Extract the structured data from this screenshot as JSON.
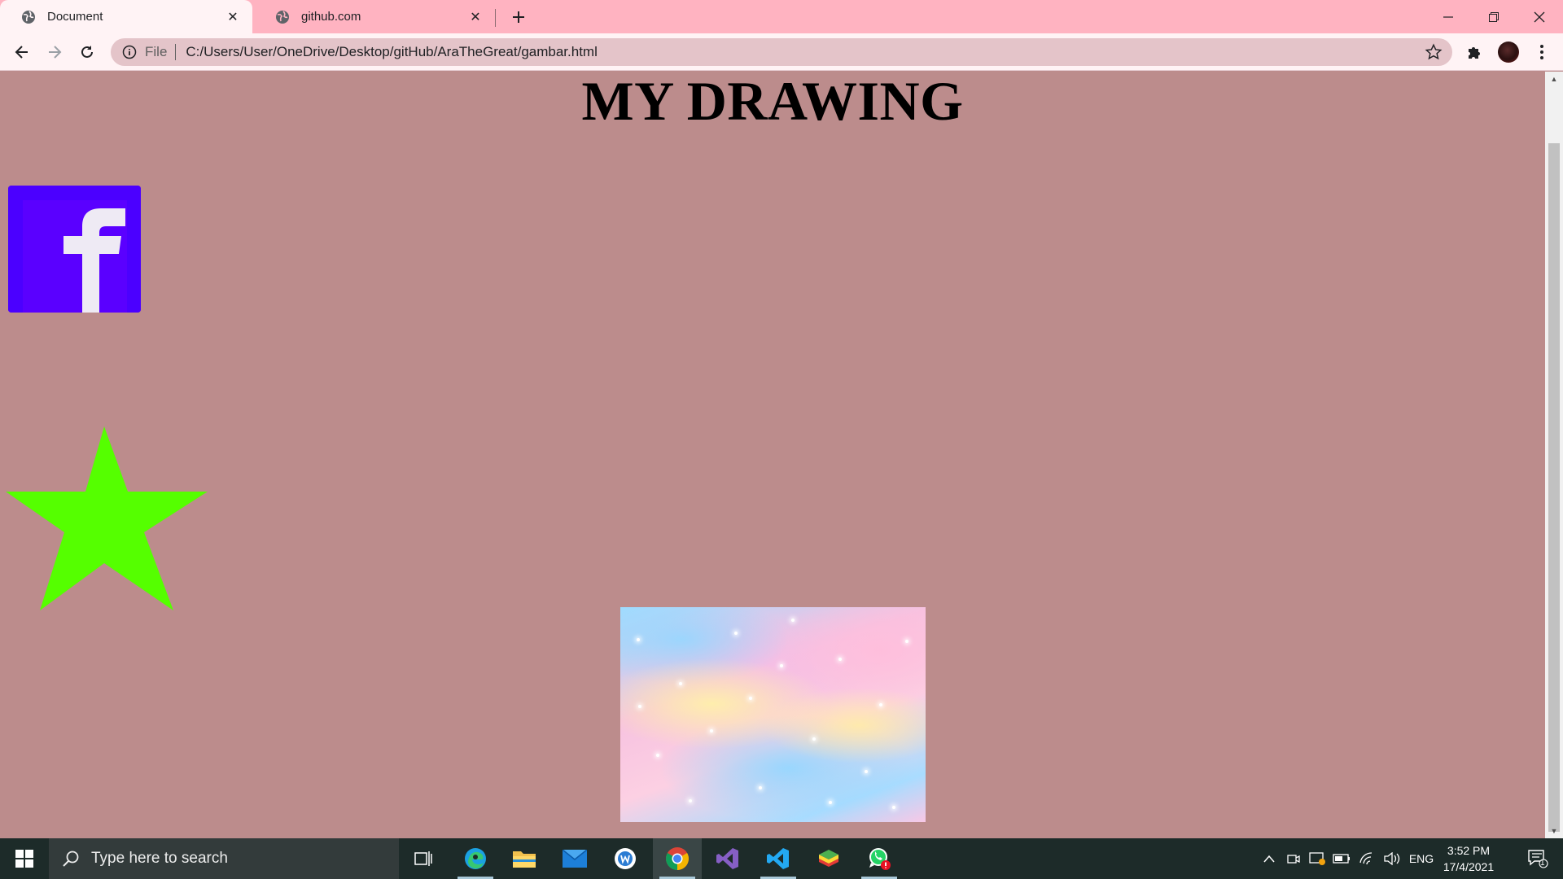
{
  "browser": {
    "tabs": [
      {
        "title": "Document",
        "active": true
      },
      {
        "title": "github.com",
        "active": false
      }
    ],
    "address": {
      "scheme_label": "File",
      "url": "C:/Users/User/OneDrive/Desktop/gitHub/AraTheGreat/gambar.html"
    }
  },
  "page": {
    "title": "MY DRAWING",
    "colors": {
      "background": "#bc8c8c",
      "facebook_box": "#4b00ff",
      "star": "#55ff00"
    }
  },
  "taskbar": {
    "search_placeholder": "Type here to search",
    "apps": [
      "task-view",
      "edge",
      "file-explorer",
      "mail",
      "word-online",
      "chrome",
      "visual-studio",
      "vs-code",
      "winrar",
      "whatsapp"
    ],
    "tray": {
      "language": "ENG",
      "time": "3:52 PM",
      "date": "17/4/2021",
      "notification_count": "1"
    }
  }
}
